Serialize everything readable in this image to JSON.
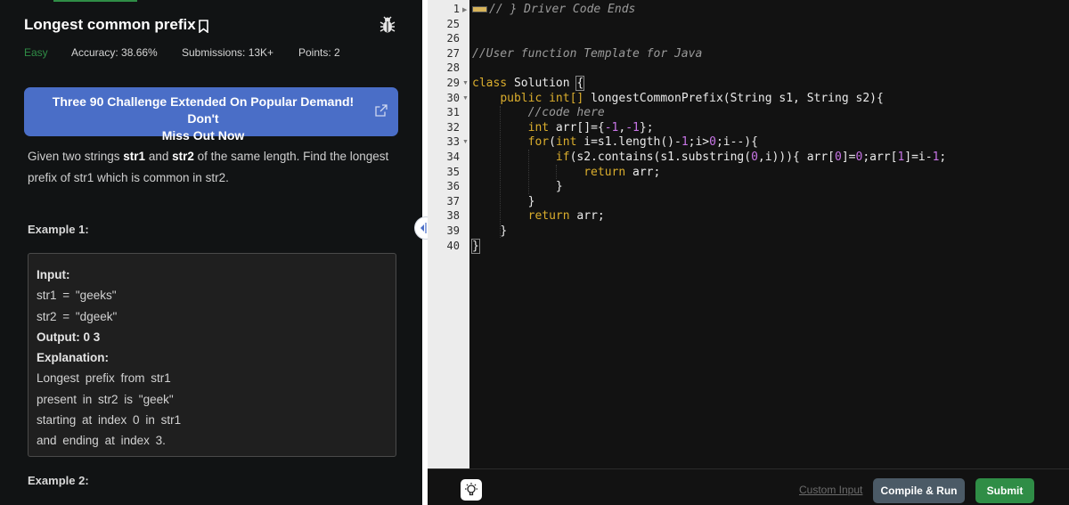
{
  "problem": {
    "title": "Longest common prefix",
    "difficulty": "Easy",
    "accuracy": "Accuracy: 38.66%",
    "submissions": "Submissions: 13K+",
    "points": "Points: 2",
    "banner_line1": "Three 90 Challenge Extended On Popular Demand! Don't",
    "banner_line2": "Miss Out Now",
    "description": {
      "p1": "Given two strings ",
      "s1": "str1",
      "p2": " and ",
      "s2": "str2",
      "p3": " of the same length. Find the longest",
      "p4": "prefix of str1 which is common in str2."
    },
    "example1_title": "Example 1:",
    "example1_lines": [
      "Input:",
      "str1 = \"geeks\"",
      "str2 = \"dgeek\"",
      "Output: 0 3",
      "Explanation:",
      "Longest prefix from str1",
      "present in str2 is \"geek\"",
      "starting at index 0 in str1",
      "and ending at index 3."
    ],
    "example2_title": "Example 2:"
  },
  "editor": {
    "line_numbers": [
      "1",
      "25",
      "26",
      "27",
      "28",
      "29",
      "30",
      "31",
      "32",
      "33",
      "34",
      "35",
      "36",
      "37",
      "38",
      "39",
      "40"
    ],
    "folded_comment": "// } Driver Code Ends",
    "template_comment": "//User function Template for Java",
    "code": {
      "l29_kw": "class",
      "l29_rest": " Solution ",
      "l30_kw": "public",
      "l30_type": " int",
      "l30_rest": " longestCommonPrefix(String s1, String s2){",
      "l31": "//code here",
      "l32_kw": "int",
      "l32_rest": " arr",
      "l33_kw": "for",
      "l33_kw2": "int",
      "l34_kw": "if",
      "l35_kw": "return",
      "l35_rest": " arr;",
      "l36": "}",
      "l37": "}",
      "l38_kw": "return",
      "l38_rest": " arr;",
      "l39": "}",
      "l40": "}"
    }
  },
  "bottom_bar": {
    "custom_input": "Custom Input",
    "compile_run": "Compile & Run",
    "submit": "Submit"
  },
  "colors": {
    "accent_green": "#2f8d46",
    "banner_blue": "#4a6ec7",
    "keyword": "#dbae2d",
    "number": "#c875e6"
  }
}
